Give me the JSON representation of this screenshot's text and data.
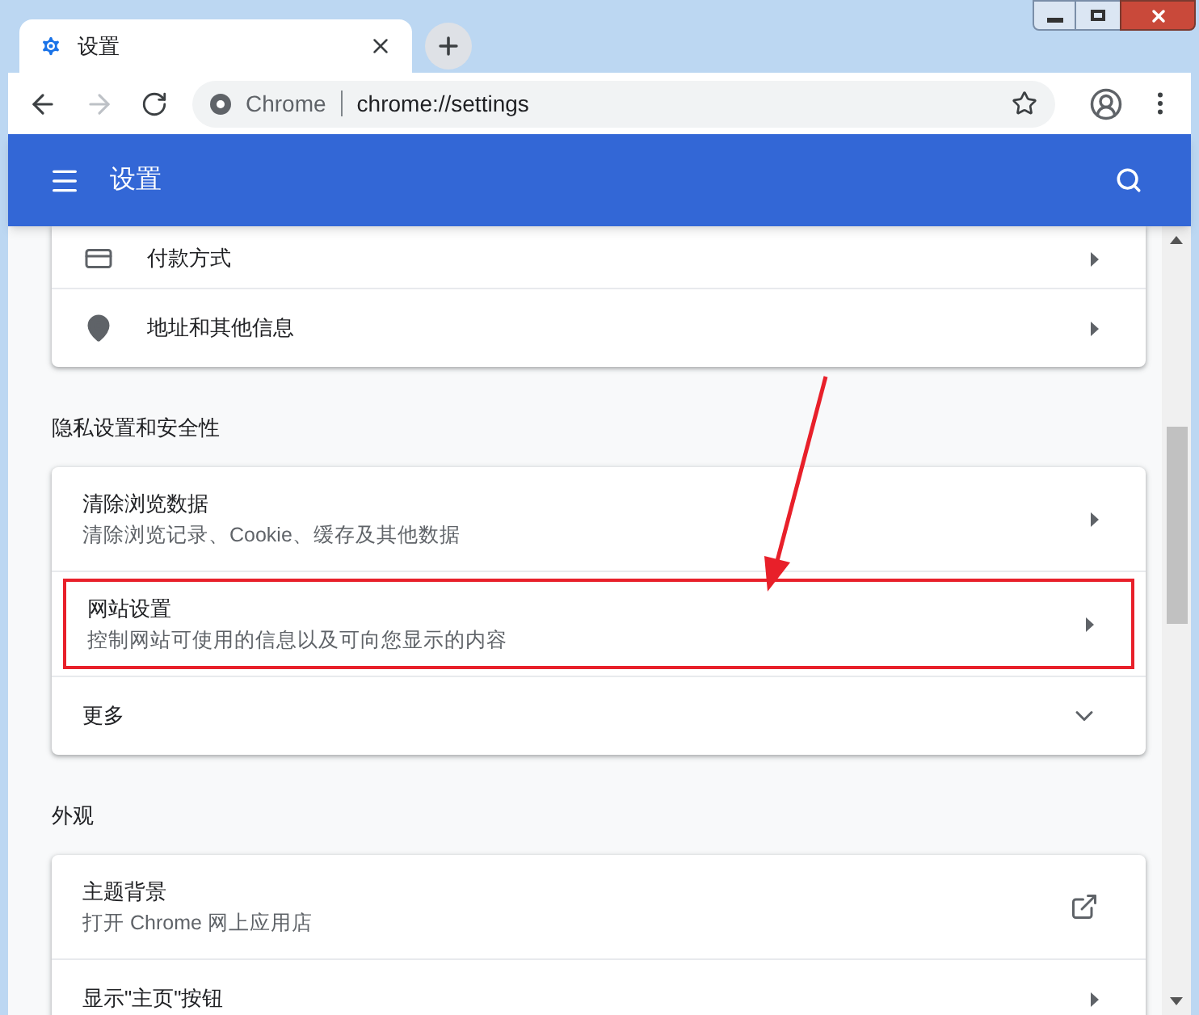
{
  "tab": {
    "title": "设置"
  },
  "address_bar": {
    "scheme": "Chrome",
    "url": "chrome://settings"
  },
  "header": {
    "title": "设置"
  },
  "sections": [
    {
      "rows": [
        {
          "kind": "nav",
          "label": "付款方式",
          "highlighted": false
        },
        {
          "kind": "nav",
          "label": "地址和其他信息",
          "highlighted": false
        }
      ]
    },
    {
      "title": "隐私设置和安全性",
      "rows": [
        {
          "kind": "nav",
          "label": "清除浏览数据",
          "description": "清除浏览记录、Cookie、缓存及其他数据",
          "highlighted": false
        },
        {
          "kind": "nav",
          "label": "网站设置",
          "description": "控制网站可使用的信息以及可向您显示的内容",
          "highlighted": true
        },
        {
          "kind": "expand",
          "label": "更多",
          "highlighted": false
        }
      ]
    },
    {
      "title": "外观",
      "rows": [
        {
          "kind": "external",
          "label": "主题背景",
          "description": "打开 Chrome 网上应用店",
          "highlighted": false
        },
        {
          "kind": "nav",
          "label": "显示\"主页\"按钮",
          "highlighted": false
        }
      ]
    }
  ]
}
